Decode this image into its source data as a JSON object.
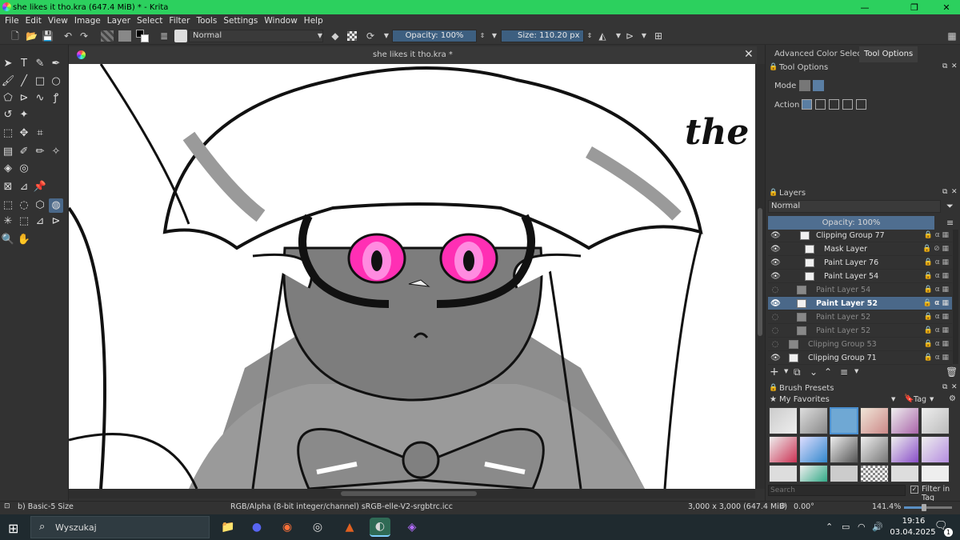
{
  "window": {
    "title": "she likes it tho.kra (647.4 MiB)  * - Krita",
    "minimize": "—",
    "maximize": "❐",
    "close": "✕"
  },
  "menu": [
    "File",
    "Edit",
    "View",
    "Image",
    "Layer",
    "Select",
    "Filter",
    "Tools",
    "Settings",
    "Window",
    "Help"
  ],
  "toolbar": {
    "blend_mode": "Normal",
    "opacity": "Opacity: 100%",
    "size": "Size: 110.20 px"
  },
  "document": {
    "tab_title": "she likes it tho.kra *",
    "canvas_text": "the"
  },
  "right_tabs": {
    "advanced": "Advanced Color Selector",
    "tool_options": "Tool Options"
  },
  "tool_options": {
    "header": "Tool Options",
    "mode_label": "Mode",
    "action_label": "Action"
  },
  "layers": {
    "header": "Layers",
    "blend": "Normal",
    "opacity": "Opacity:  100%",
    "rows": [
      {
        "name": "Clipping Group 77",
        "state": "visible"
      },
      {
        "name": "Mask Layer",
        "state": "visible"
      },
      {
        "name": "Paint Layer 76",
        "state": "visible"
      },
      {
        "name": "Paint Layer 54",
        "state": "visible"
      },
      {
        "name": "Paint Layer 54",
        "state": "hidden"
      },
      {
        "name": "Paint Layer 52",
        "state": "selected"
      },
      {
        "name": "Paint Layer 52",
        "state": "hidden"
      },
      {
        "name": "Paint Layer 52",
        "state": "hidden"
      },
      {
        "name": "Clipping Group 53",
        "state": "hidden"
      },
      {
        "name": "Clipping Group 71",
        "state": "visible"
      }
    ]
  },
  "brush_presets": {
    "header": "Brush Presets",
    "favorites": "My Favorites",
    "tag": "Tag",
    "search_placeholder": "Search",
    "filter_label": "Filter in Tag"
  },
  "status": {
    "brush": "b) Basic-5 Size",
    "color_space": "RGB/Alpha (8-bit integer/channel)  sRGB-elle-V2-srgbtrc.icc",
    "dims": "3,000 x 3,000 (647.4 MiB)",
    "rotation": "0.00°",
    "zoom": "141.4%"
  },
  "taskbar": {
    "search": "Wyszukaj",
    "time": "19:16",
    "date": "03.04.2025",
    "notifications": "1"
  },
  "colors": {
    "titlebar": "#2cd05e",
    "accent": "#4a6889",
    "eye_pink": "#ff2fb4"
  }
}
